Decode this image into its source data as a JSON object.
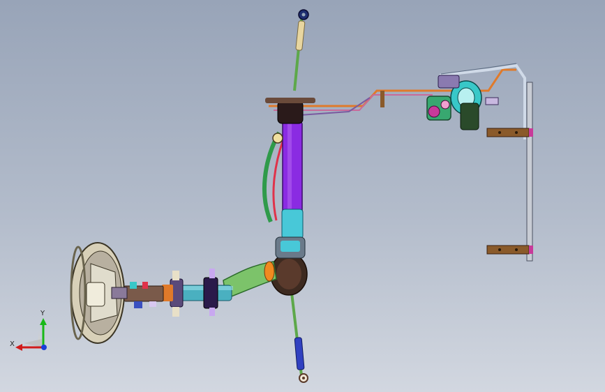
{
  "triad": {
    "x_label": "X",
    "y_label": "Y"
  },
  "colors": {
    "background_top": "#98a4b8",
    "background_bottom": "#d2d7e0",
    "x_axis": "#d11a1a",
    "y_axis": "#18b818",
    "z_axis": "#1a3fd8",
    "steering_rack": "#8a2be2",
    "intermediate_shaft": "#7cc36a",
    "tie_rod_boot": "#3d2a20",
    "hydraulic_line_orange": "#e07a2a",
    "hydraulic_line_green": "#2f9a4a",
    "hydraulic_line_red": "#e0324a",
    "bracket_brown": "#8a5a2a",
    "pump_cyan": "#38c8c8"
  }
}
